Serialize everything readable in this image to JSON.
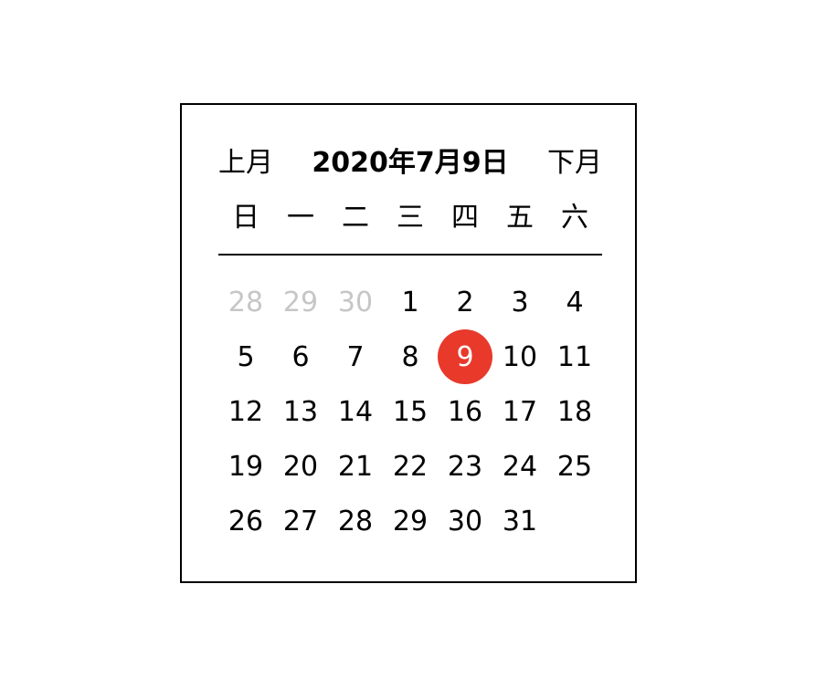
{
  "header": {
    "prev_label": "上月",
    "current_date": "2020年7月9日",
    "next_label": "下月"
  },
  "weekdays": [
    "日",
    "一",
    "二",
    "三",
    "四",
    "五",
    "六"
  ],
  "days": [
    {
      "label": "28",
      "other_month": true
    },
    {
      "label": "29",
      "other_month": true
    },
    {
      "label": "30",
      "other_month": true
    },
    {
      "label": "1"
    },
    {
      "label": "2"
    },
    {
      "label": "3"
    },
    {
      "label": "4"
    },
    {
      "label": "5"
    },
    {
      "label": "6"
    },
    {
      "label": "7"
    },
    {
      "label": "8"
    },
    {
      "label": "9",
      "selected": true
    },
    {
      "label": "10"
    },
    {
      "label": "11"
    },
    {
      "label": "12"
    },
    {
      "label": "13"
    },
    {
      "label": "14"
    },
    {
      "label": "15"
    },
    {
      "label": "16"
    },
    {
      "label": "17"
    },
    {
      "label": "18"
    },
    {
      "label": "19"
    },
    {
      "label": "20"
    },
    {
      "label": "21"
    },
    {
      "label": "22"
    },
    {
      "label": "23"
    },
    {
      "label": "24"
    },
    {
      "label": "25"
    },
    {
      "label": "26"
    },
    {
      "label": "27"
    },
    {
      "label": "28"
    },
    {
      "label": "29"
    },
    {
      "label": "30"
    },
    {
      "label": "31"
    }
  ],
  "colors": {
    "selected_background": "#e8392b",
    "other_month_text": "#c6c6c6",
    "border": "#000000"
  }
}
